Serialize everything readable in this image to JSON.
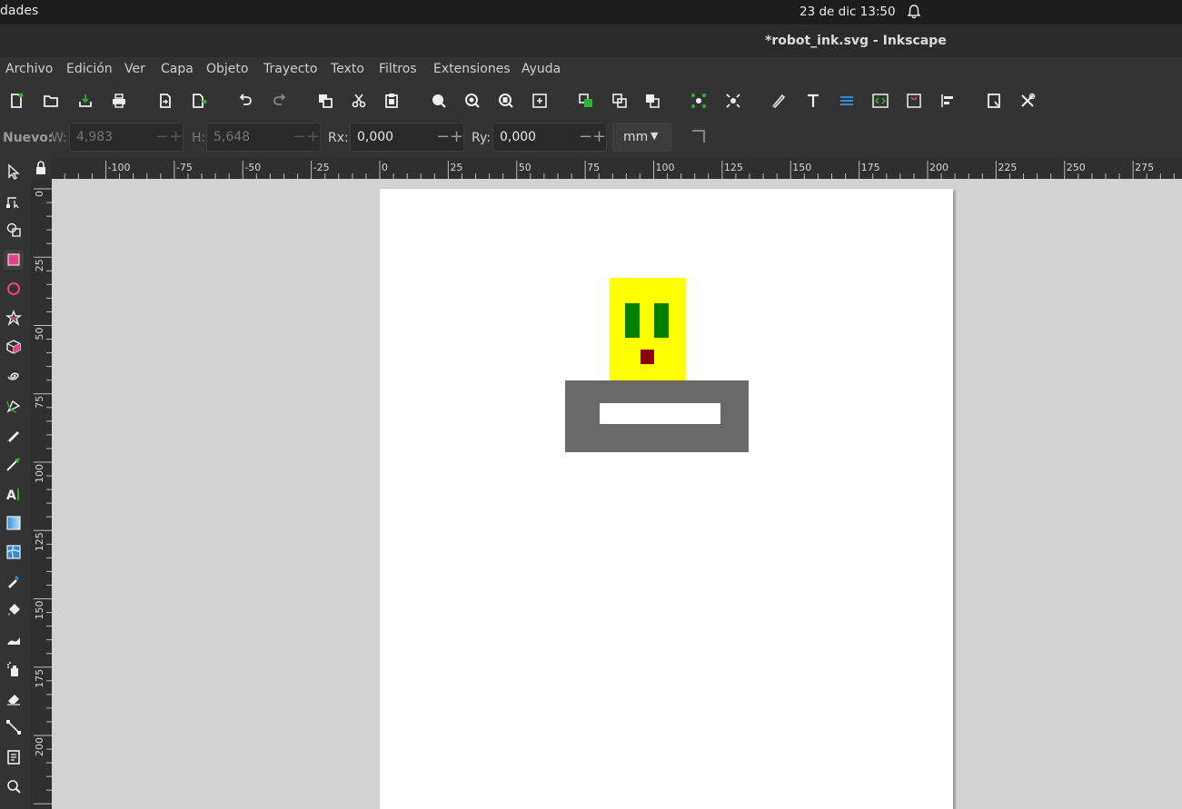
{
  "system_bar": {
    "activities": "dades",
    "clock": "23 de dic  13:50",
    "bell_icon": "bell-icon"
  },
  "window": {
    "title": "*robot_ink.svg - Inkscape"
  },
  "menu": [
    "Archivo",
    "Edición",
    "Ver",
    "Capa",
    "Objeto",
    "Trayecto",
    "Texto",
    "Filtros",
    "Extensiones",
    "Ayuda"
  ],
  "controls": {
    "mode_label": "Nuevo:",
    "w_label": "W:",
    "w_value": "4,983",
    "h_label": "H:",
    "h_value": "5,648",
    "rx_label": "Rx:",
    "rx_value": "0,000",
    "ry_label": "Ry:",
    "ry_value": "0,000",
    "unit": "mm"
  },
  "ruler": {
    "h_labels": [
      "-100",
      "-75",
      "-50",
      "-25",
      "0",
      "25",
      "50",
      "75",
      "100",
      "125",
      "150",
      "175",
      "200",
      "225",
      "250",
      "275"
    ],
    "v_labels": [
      "0",
      "25",
      "50",
      "75",
      "100",
      "125",
      "150",
      "175",
      "200"
    ]
  },
  "drawing": {
    "head_color": "#ffff00",
    "eye_color": "#008000",
    "mouth_color": "#8b0000",
    "body_color": "#696969",
    "slot_color": "#ffffff"
  }
}
